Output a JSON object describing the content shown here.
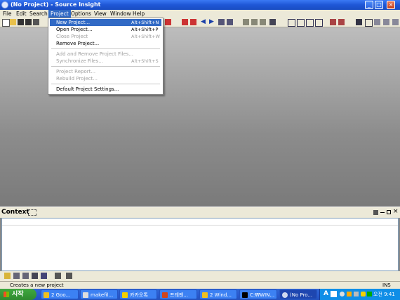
{
  "window": {
    "title": "(No Project) - Source Insight"
  },
  "menubar": {
    "items": [
      "File",
      "Edit",
      "Search",
      "Project",
      "Options",
      "View",
      "Window",
      "Help"
    ],
    "active": "Project"
  },
  "project_menu": {
    "items": [
      {
        "label": "New Project...",
        "shortcut": "Alt+Shift+N",
        "state": "highlighted"
      },
      {
        "label": "Open Project...",
        "shortcut": "Alt+Shift+P",
        "state": "enabled"
      },
      {
        "label": "Close Project",
        "shortcut": "Alt+Shift+W",
        "state": "disabled"
      },
      {
        "label": "Remove Project...",
        "shortcut": "",
        "state": "enabled"
      },
      {
        "label": "Add and Remove Project Files...",
        "shortcut": "",
        "state": "disabled"
      },
      {
        "label": "Synchronize Files...",
        "shortcut": "Alt+Shift+S",
        "state": "disabled"
      },
      {
        "label": "Project Report...",
        "shortcut": "",
        "state": "disabled"
      },
      {
        "label": "Rebuild Project...",
        "shortcut": "",
        "state": "disabled"
      },
      {
        "label": "Default Project Settings...",
        "shortcut": "",
        "state": "enabled"
      }
    ]
  },
  "context": {
    "title": "Context"
  },
  "statusbar": {
    "message": "Creates a new project",
    "mode": "INS"
  },
  "taskbar": {
    "start_label": "시작",
    "tasks": [
      "2 Goo...",
      "makefil...",
      "카카오톡",
      "프레젠...",
      "2 Wind...",
      "C:₩WIN...",
      "(No Pro..."
    ],
    "clock": "오전 9:41"
  },
  "colors": {
    "titlebar": "#1f57d6",
    "menu_highlight": "#316ac5",
    "taskbar": "#2a5bd0",
    "start": "#2f8a2f"
  }
}
